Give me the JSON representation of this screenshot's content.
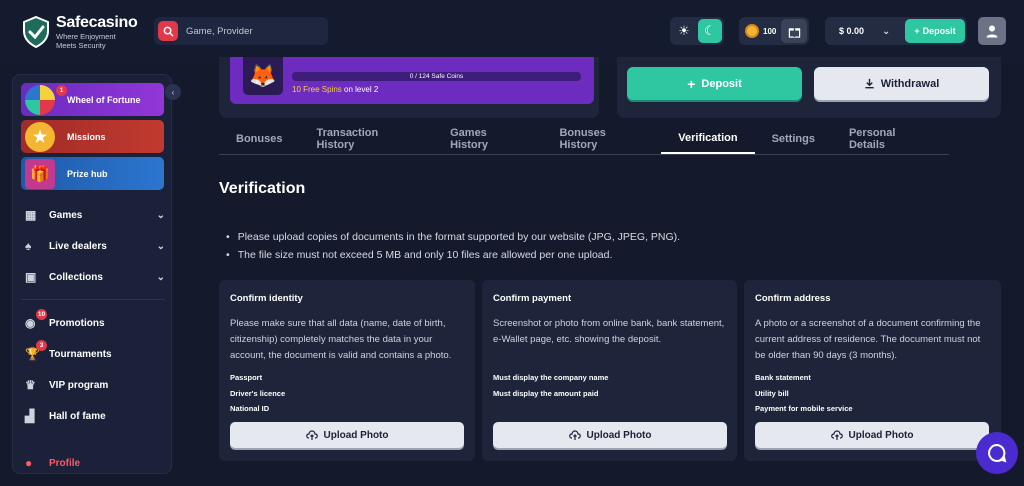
{
  "header": {
    "brand_name": "Safecasino",
    "brand_tagline_1": "Where Enjoyment",
    "brand_tagline_2": "Meets Security",
    "search_placeholder": "Game, Provider",
    "coins": "100",
    "balance": "$ 0.00",
    "deposit_label": "Deposit"
  },
  "sidebar": {
    "promos": [
      {
        "label": "Wheel of Fortune",
        "badge": "1"
      },
      {
        "label": "Missions"
      },
      {
        "label": "Prize hub"
      }
    ],
    "nav": [
      {
        "label": "Games"
      },
      {
        "label": "Live dealers"
      },
      {
        "label": "Collections"
      },
      {
        "label": "Promotions",
        "badge": "10"
      },
      {
        "label": "Tournaments",
        "badge": "3"
      },
      {
        "label": "VIP program"
      },
      {
        "label": "Hall of fame"
      },
      {
        "label": "Profile"
      }
    ]
  },
  "bonus": {
    "progress_text": "0 / 124 Safe Coins",
    "progress_fraction": 0,
    "spins_highlight": "10 Free Spins",
    "spins_rest": " on level 2"
  },
  "wallet": {
    "deposit_label": "Deposit",
    "withdraw_label": "Withdrawal"
  },
  "tabs": [
    "Bonuses",
    "Transaction History",
    "Games History",
    "Bonuses History",
    "Verification",
    "Settings",
    "Personal Details"
  ],
  "active_tab": "Verification",
  "verification": {
    "title": "Verification",
    "notes": [
      "Please upload copies of documents in the format supported by our website (JPG, JPEG, PNG).",
      "The file size must not exceed 5 MB and only 10 files are allowed per one upload."
    ],
    "cards": [
      {
        "title": "Confirm identity",
        "description": "Please make sure that all data (name, date of birth, citizenship) completely matches the data in your account, the document is valid and contains a photo.",
        "requirements": [
          "Passport",
          "Driver's licence",
          "National ID"
        ],
        "button": "Upload Photo"
      },
      {
        "title": "Confirm payment",
        "description": "Screenshot or photo from online bank, bank statement, e-Wallet page, etc. showing the deposit.",
        "requirements": [
          "Must display the company name",
          "Must display the amount paid"
        ],
        "button": "Upload Photo"
      },
      {
        "title": "Confirm address",
        "description": "A photo or a screenshot of a document confirming the current address of residence. The document must not be older than 90 days (3 months).",
        "requirements": [
          "Bank statement",
          "Utility bill",
          "Payment for mobile service"
        ],
        "button": "Upload Photo"
      }
    ]
  },
  "colors": {
    "accent": "#2fc6a2",
    "background": "#141a2c",
    "card": "#1e253b",
    "brand_red": "#e2394a",
    "chat": "#4a2bd0"
  }
}
